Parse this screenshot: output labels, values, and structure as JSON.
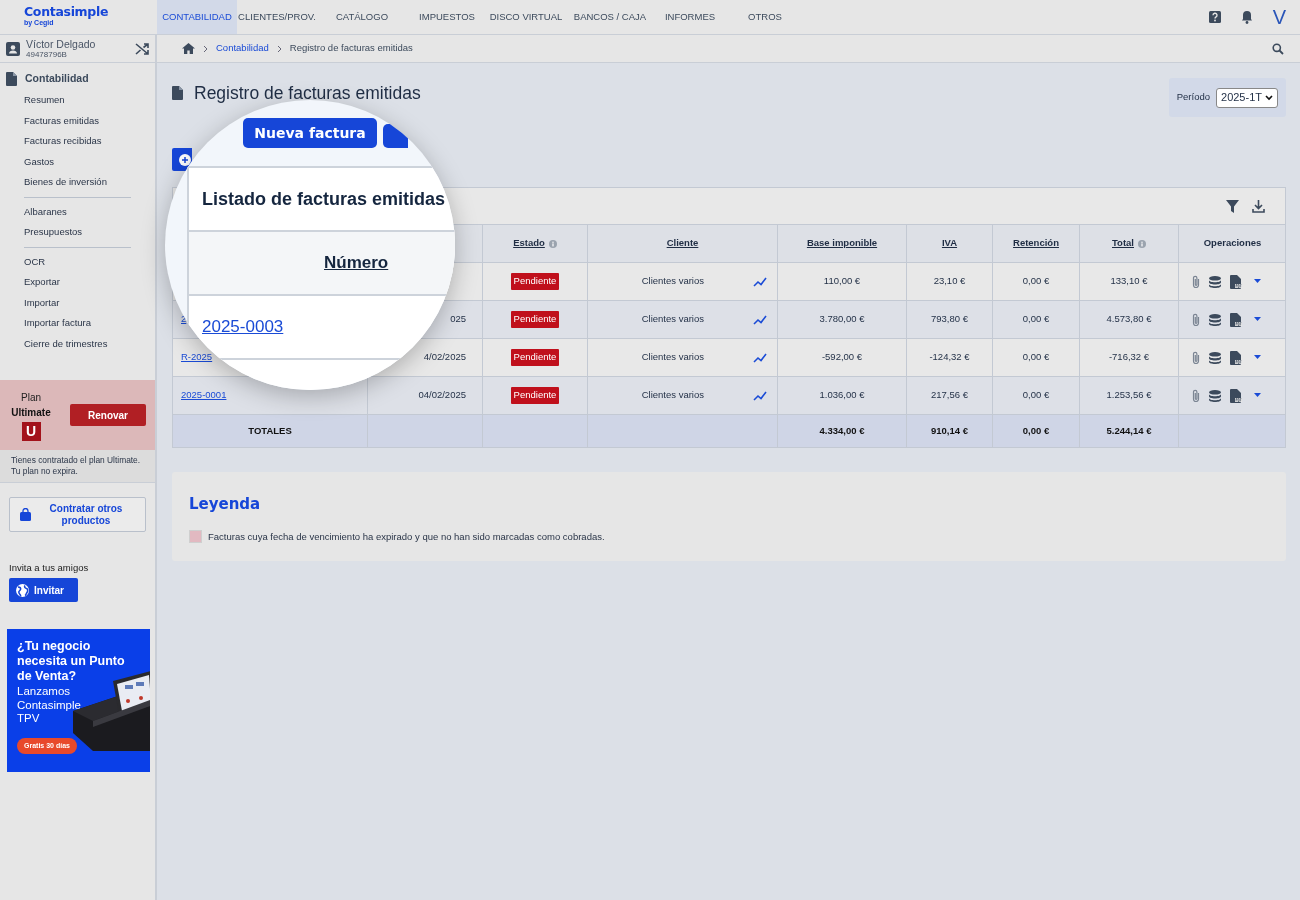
{
  "header": {
    "logo": "Contasimple",
    "logo_sub": "by Cegid",
    "user_initial": "V"
  },
  "nav": [
    {
      "label": "CONTABILIDAD",
      "selected": true
    },
    {
      "label": "CLIENTES/PROV.",
      "selected": false
    },
    {
      "label": "CATÁLOGO",
      "selected": false
    },
    {
      "label": "IMPUESTOS",
      "selected": false
    },
    {
      "label": "DISCO VIRTUAL",
      "selected": false
    },
    {
      "label": "BANCOS / CAJA",
      "selected": false
    },
    {
      "label": "INFORMES",
      "selected": false
    },
    {
      "label": "OTROS",
      "selected": false
    }
  ],
  "breadcrumb": [
    "Contabilidad",
    "Registro de facturas emitidas"
  ],
  "sidebar": {
    "user": {
      "name": "Víctor Delgado",
      "id": "49478796B"
    },
    "section": "Contabilidad",
    "groups": [
      [
        "Resumen",
        "Facturas emitidas",
        "Facturas recibidas",
        "Gastos",
        "Bienes de inversión"
      ],
      [
        "Albaranes",
        "Presupuestos"
      ],
      [
        "OCR",
        "Exportar",
        "Importar",
        "Importar factura",
        "Cierre de trimestres"
      ]
    ],
    "plan": {
      "label": "Plan",
      "name": "Ultimate",
      "badge": "U",
      "button": "Renovar",
      "note": "Tienes contratado el plan Ultimate. Tu plan no expira."
    },
    "buy_button": "Contratar otros productos",
    "invite": {
      "label": "Invita a tus amigos",
      "button": "Invitar"
    },
    "ad": {
      "headline": "¿Tu negocio necesita un Punto de Venta?",
      "body": "Lanzamos Contasimple TPV",
      "badge": "Gratis 30 días"
    }
  },
  "page": {
    "title": "Registro de facturas emitidas",
    "period": {
      "label": "Período",
      "value": "2025-1T"
    }
  },
  "table": {
    "columns": [
      {
        "label": "Estado",
        "sortable": true,
        "info": true
      },
      {
        "label": "Cliente",
        "sortable": true,
        "info": false
      },
      {
        "label": "Base imponible",
        "sortable": true,
        "info": false
      },
      {
        "label": "IVA",
        "sortable": true,
        "info": false
      },
      {
        "label": "Retención",
        "sortable": true,
        "info": false
      },
      {
        "label": "Total",
        "sortable": true,
        "info": true
      },
      {
        "label": "Operaciones",
        "sortable": false,
        "info": false
      }
    ],
    "rows": [
      {
        "estado": "Pendiente",
        "cliente": "Clientes varios",
        "base": "110,00 €",
        "iva": "23,10 €",
        "retencion": "0,00 €",
        "total": "133,10 €"
      },
      {
        "numero": "2",
        "fecha": "025",
        "estado": "Pendiente",
        "cliente": "Clientes varios",
        "base": "3.780,00 €",
        "iva": "793,80 €",
        "retencion": "0,00 €",
        "total": "4.573,80 €"
      },
      {
        "numero": "R-2025",
        "fecha": "4/02/2025",
        "estado": "Pendiente",
        "cliente": "Clientes varios",
        "base": "-592,00 €",
        "iva": "-124,32 €",
        "retencion": "0,00 €",
        "total": "-716,32 €"
      },
      {
        "numero": "2025-0001",
        "fecha": "04/02/2025",
        "estado": "Pendiente",
        "cliente": "Clientes varios",
        "base": "1.036,00 €",
        "iva": "217,56 €",
        "retencion": "0,00 €",
        "total": "1.253,56 €"
      }
    ],
    "totals": {
      "label": "TOTALES",
      "base": "4.334,00 €",
      "iva": "910,14 €",
      "retencion": "0,00 €",
      "total": "5.244,14 €"
    }
  },
  "magnifier": {
    "button": "Nueva factura",
    "title": "Listado de facturas emitidas",
    "column": "Número",
    "link": "2025-0003"
  },
  "legend": {
    "title": "Leyenda",
    "items": [
      {
        "text": "Facturas cuya fecha de vencimiento ha expirado y que no han sido marcadas como cobradas.",
        "color": "#e2b9c1"
      }
    ]
  }
}
